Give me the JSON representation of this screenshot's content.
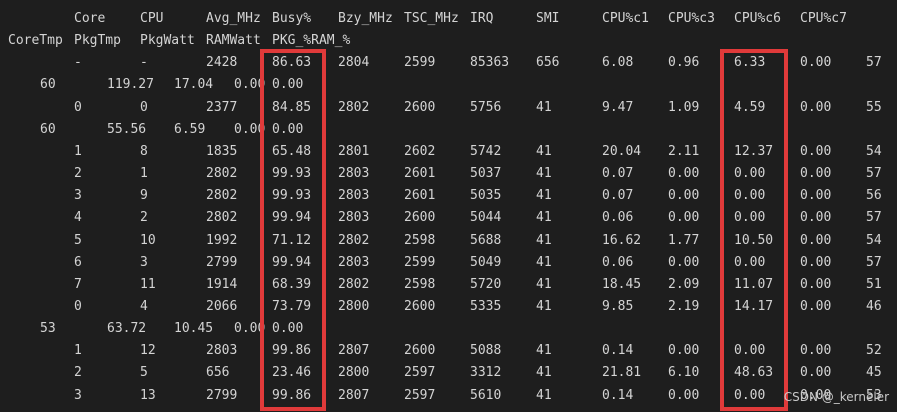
{
  "colors": {
    "background": "#1e1e1e",
    "text": "#d4d4d4",
    "highlight": "#e03a3a"
  },
  "lines": [
    [
      "",
      "Core",
      "CPU",
      "Avg_MHz",
      "Busy%",
      "Bzy_MHz",
      "TSC_MHz",
      "IRQ",
      "SMI",
      "CPU%c1",
      "CPU%c3",
      "CPU%c6",
      "CPU%c7"
    ],
    [
      "CoreTmp",
      "PkgTmp",
      "PkgWatt",
      "RAMWatt",
      "PKG_%RAM_%"
    ],
    [
      "",
      "-",
      "-",
      "2428",
      "86.63",
      "2804",
      "2599",
      "85363",
      "656",
      "6.08",
      "0.96",
      "6.33",
      "0.00",
      "57"
    ],
    [
      "60",
      "119.27",
      "17.04",
      "0.00",
      "0.00"
    ],
    [
      "",
      "0",
      "0",
      "2377",
      "84.85",
      "2802",
      "2600",
      "5756",
      "41",
      "9.47",
      "1.09",
      "4.59",
      "0.00",
      "55"
    ],
    [
      "60",
      "55.56",
      "6.59",
      "0.00",
      "0.00"
    ],
    [
      "",
      "1",
      "8",
      "1835",
      "65.48",
      "2801",
      "2602",
      "5742",
      "41",
      "20.04",
      "2.11",
      "12.37",
      "0.00",
      "54"
    ],
    [
      "",
      "2",
      "1",
      "2802",
      "99.93",
      "2803",
      "2601",
      "5037",
      "41",
      "0.07",
      "0.00",
      "0.00",
      "0.00",
      "57"
    ],
    [
      "",
      "3",
      "9",
      "2802",
      "99.93",
      "2803",
      "2601",
      "5035",
      "41",
      "0.07",
      "0.00",
      "0.00",
      "0.00",
      "56"
    ],
    [
      "",
      "4",
      "2",
      "2802",
      "99.94",
      "2803",
      "2600",
      "5044",
      "41",
      "0.06",
      "0.00",
      "0.00",
      "0.00",
      "57"
    ],
    [
      "",
      "5",
      "10",
      "1992",
      "71.12",
      "2802",
      "2598",
      "5688",
      "41",
      "16.62",
      "1.77",
      "10.50",
      "0.00",
      "54"
    ],
    [
      "",
      "6",
      "3",
      "2799",
      "99.94",
      "2803",
      "2599",
      "5049",
      "41",
      "0.06",
      "0.00",
      "0.00",
      "0.00",
      "57"
    ],
    [
      "",
      "7",
      "11",
      "1914",
      "68.39",
      "2802",
      "2598",
      "5720",
      "41",
      "18.45",
      "2.09",
      "11.07",
      "0.00",
      "51"
    ],
    [
      "",
      "0",
      "4",
      "2066",
      "73.79",
      "2800",
      "2600",
      "5335",
      "41",
      "9.85",
      "2.19",
      "14.17",
      "0.00",
      "46"
    ],
    [
      "53",
      "63.72",
      "10.45",
      "0.00",
      "0.00"
    ],
    [
      "",
      "1",
      "12",
      "2803",
      "99.86",
      "2807",
      "2600",
      "5088",
      "41",
      "0.14",
      "0.00",
      "0.00",
      "0.00",
      "52"
    ],
    [
      "",
      "2",
      "5",
      "656",
      "23.46",
      "2800",
      "2597",
      "3312",
      "41",
      "21.81",
      "6.10",
      "48.63",
      "0.00",
      "45"
    ],
    [
      "",
      "3",
      "13",
      "2799",
      "99.86",
      "2807",
      "2597",
      "5610",
      "41",
      "0.14",
      "0.00",
      "0.00",
      "0.00",
      "53"
    ]
  ],
  "watermark": "CSDN @_kerneler"
}
